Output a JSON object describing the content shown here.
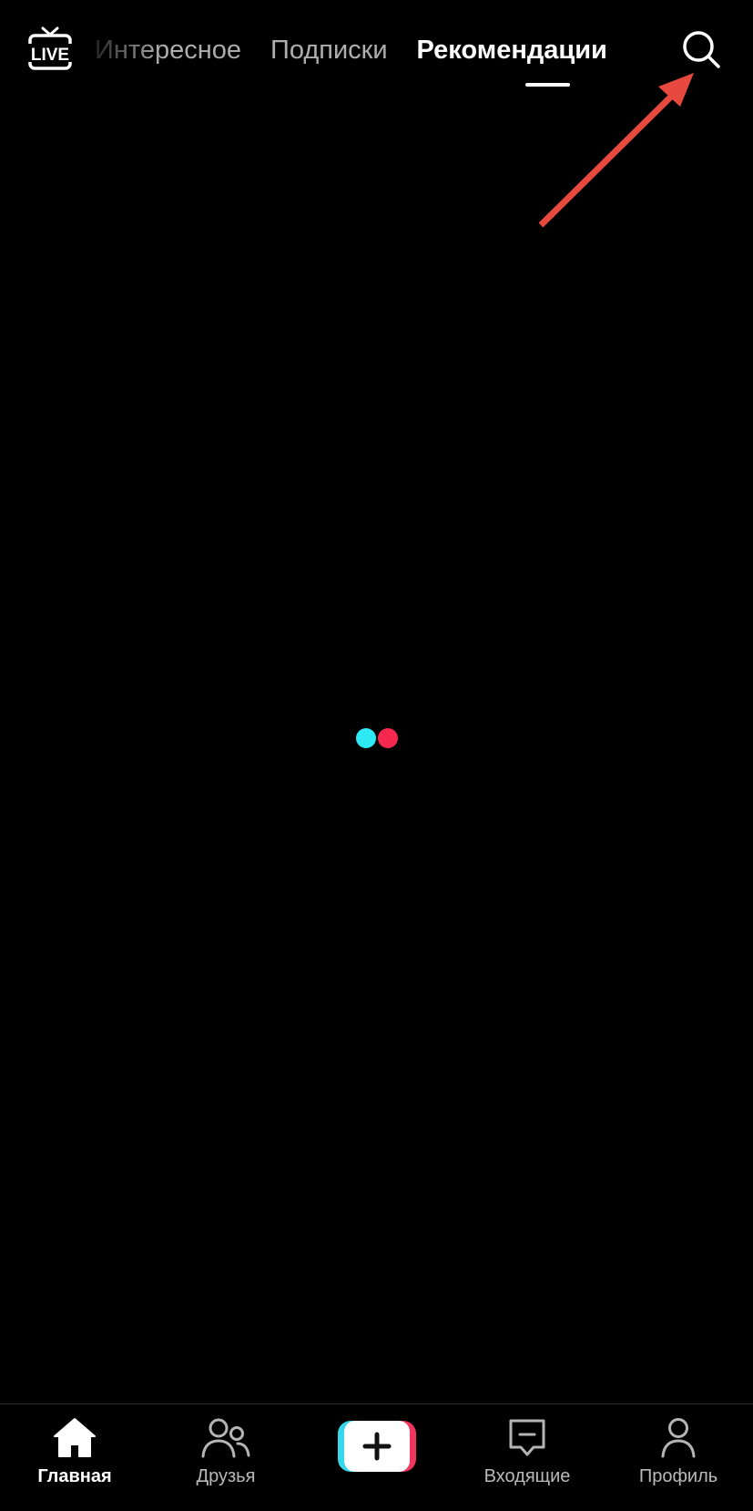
{
  "header": {
    "live_icon": "live-tv-icon",
    "tabs": [
      {
        "label": "Интересное",
        "state": "faded"
      },
      {
        "label": "Подписки",
        "state": "inactive"
      },
      {
        "label": "Рекомендации",
        "state": "active"
      }
    ],
    "search_icon": "search-icon"
  },
  "annotation": {
    "type": "arrow",
    "color": "#e8493f",
    "points_to": "search-icon"
  },
  "loader": {
    "dot_colors": [
      "#2ee8f3",
      "#f7284f"
    ]
  },
  "bottom_nav": {
    "items": [
      {
        "label": "Главная",
        "icon": "home-icon",
        "active": true
      },
      {
        "label": "Друзья",
        "icon": "friends-icon",
        "active": false
      },
      {
        "label": "",
        "icon": "plus-icon",
        "active": false
      },
      {
        "label": "Входящие",
        "icon": "inbox-icon",
        "active": false
      },
      {
        "label": "Профиль",
        "icon": "profile-icon",
        "active": false
      }
    ],
    "create_colors": {
      "cyan": "#36d7ea",
      "red": "#f0355f",
      "white": "#ffffff"
    }
  },
  "colors": {
    "background": "#000000",
    "text_active": "#ffffff",
    "text_inactive": "#b5b5b5"
  }
}
